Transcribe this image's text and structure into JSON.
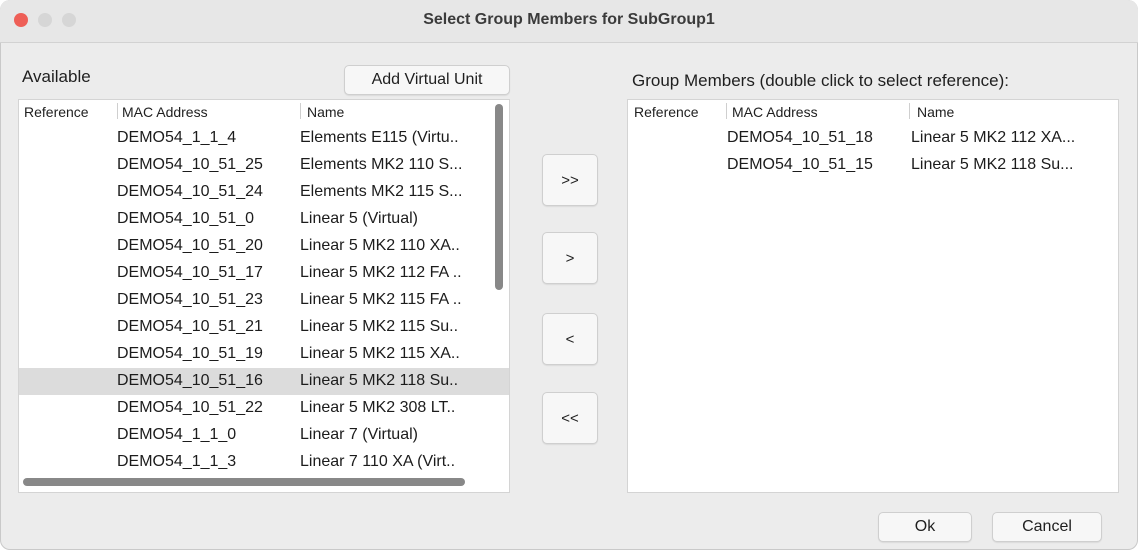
{
  "window": {
    "title": "Select Group Members for SubGroup1"
  },
  "available": {
    "label": "Available",
    "add_virtual_label": "Add Virtual Unit",
    "columns": {
      "reference": "Reference",
      "mac": "MAC Address",
      "name": "Name"
    },
    "rows": [
      {
        "reference": "",
        "mac": "DEMO54_1_1_4",
        "name": "Elements E115 (Virtu.."
      },
      {
        "reference": "",
        "mac": "DEMO54_10_51_25",
        "name": "Elements MK2 110 S..."
      },
      {
        "reference": "",
        "mac": "DEMO54_10_51_24",
        "name": "Elements MK2 115 S..."
      },
      {
        "reference": "",
        "mac": "DEMO54_10_51_0",
        "name": "Linear 5 (Virtual)"
      },
      {
        "reference": "",
        "mac": "DEMO54_10_51_20",
        "name": "Linear 5 MK2 110 XA.."
      },
      {
        "reference": "",
        "mac": "DEMO54_10_51_17",
        "name": "Linear 5 MK2 112 FA .."
      },
      {
        "reference": "",
        "mac": "DEMO54_10_51_23",
        "name": "Linear 5 MK2 115 FA .."
      },
      {
        "reference": "",
        "mac": "DEMO54_10_51_21",
        "name": "Linear 5 MK2 115 Su.."
      },
      {
        "reference": "",
        "mac": "DEMO54_10_51_19",
        "name": "Linear 5 MK2 115 XA.."
      },
      {
        "reference": "",
        "mac": "DEMO54_10_51_16",
        "name": "Linear 5 MK2 118 Su..",
        "selected": true
      },
      {
        "reference": "",
        "mac": "DEMO54_10_51_22",
        "name": "Linear 5 MK2 308 LT.."
      },
      {
        "reference": "",
        "mac": "DEMO54_1_1_0",
        "name": "Linear 7 (Virtual)"
      },
      {
        "reference": "",
        "mac": "DEMO54_1_1_3",
        "name": "Linear 7 110 XA (Virt.."
      }
    ]
  },
  "transfer": {
    "add_all": ">>",
    "add": ">",
    "remove": "<",
    "remove_all": "<<"
  },
  "members": {
    "label": "Group Members (double click to select reference):",
    "columns": {
      "reference": "Reference",
      "mac": "MAC Address",
      "name": "Name"
    },
    "rows": [
      {
        "reference": "",
        "mac": "DEMO54_10_51_18",
        "name": "Linear 5 MK2 112 XA..."
      },
      {
        "reference": "",
        "mac": "DEMO54_10_51_15",
        "name": "Linear 5 MK2 118 Su..."
      }
    ]
  },
  "footer": {
    "ok_label": "Ok",
    "cancel_label": "Cancel"
  },
  "colors": {
    "close": "#ee5f57",
    "selected_row": "#dcdcdc"
  }
}
